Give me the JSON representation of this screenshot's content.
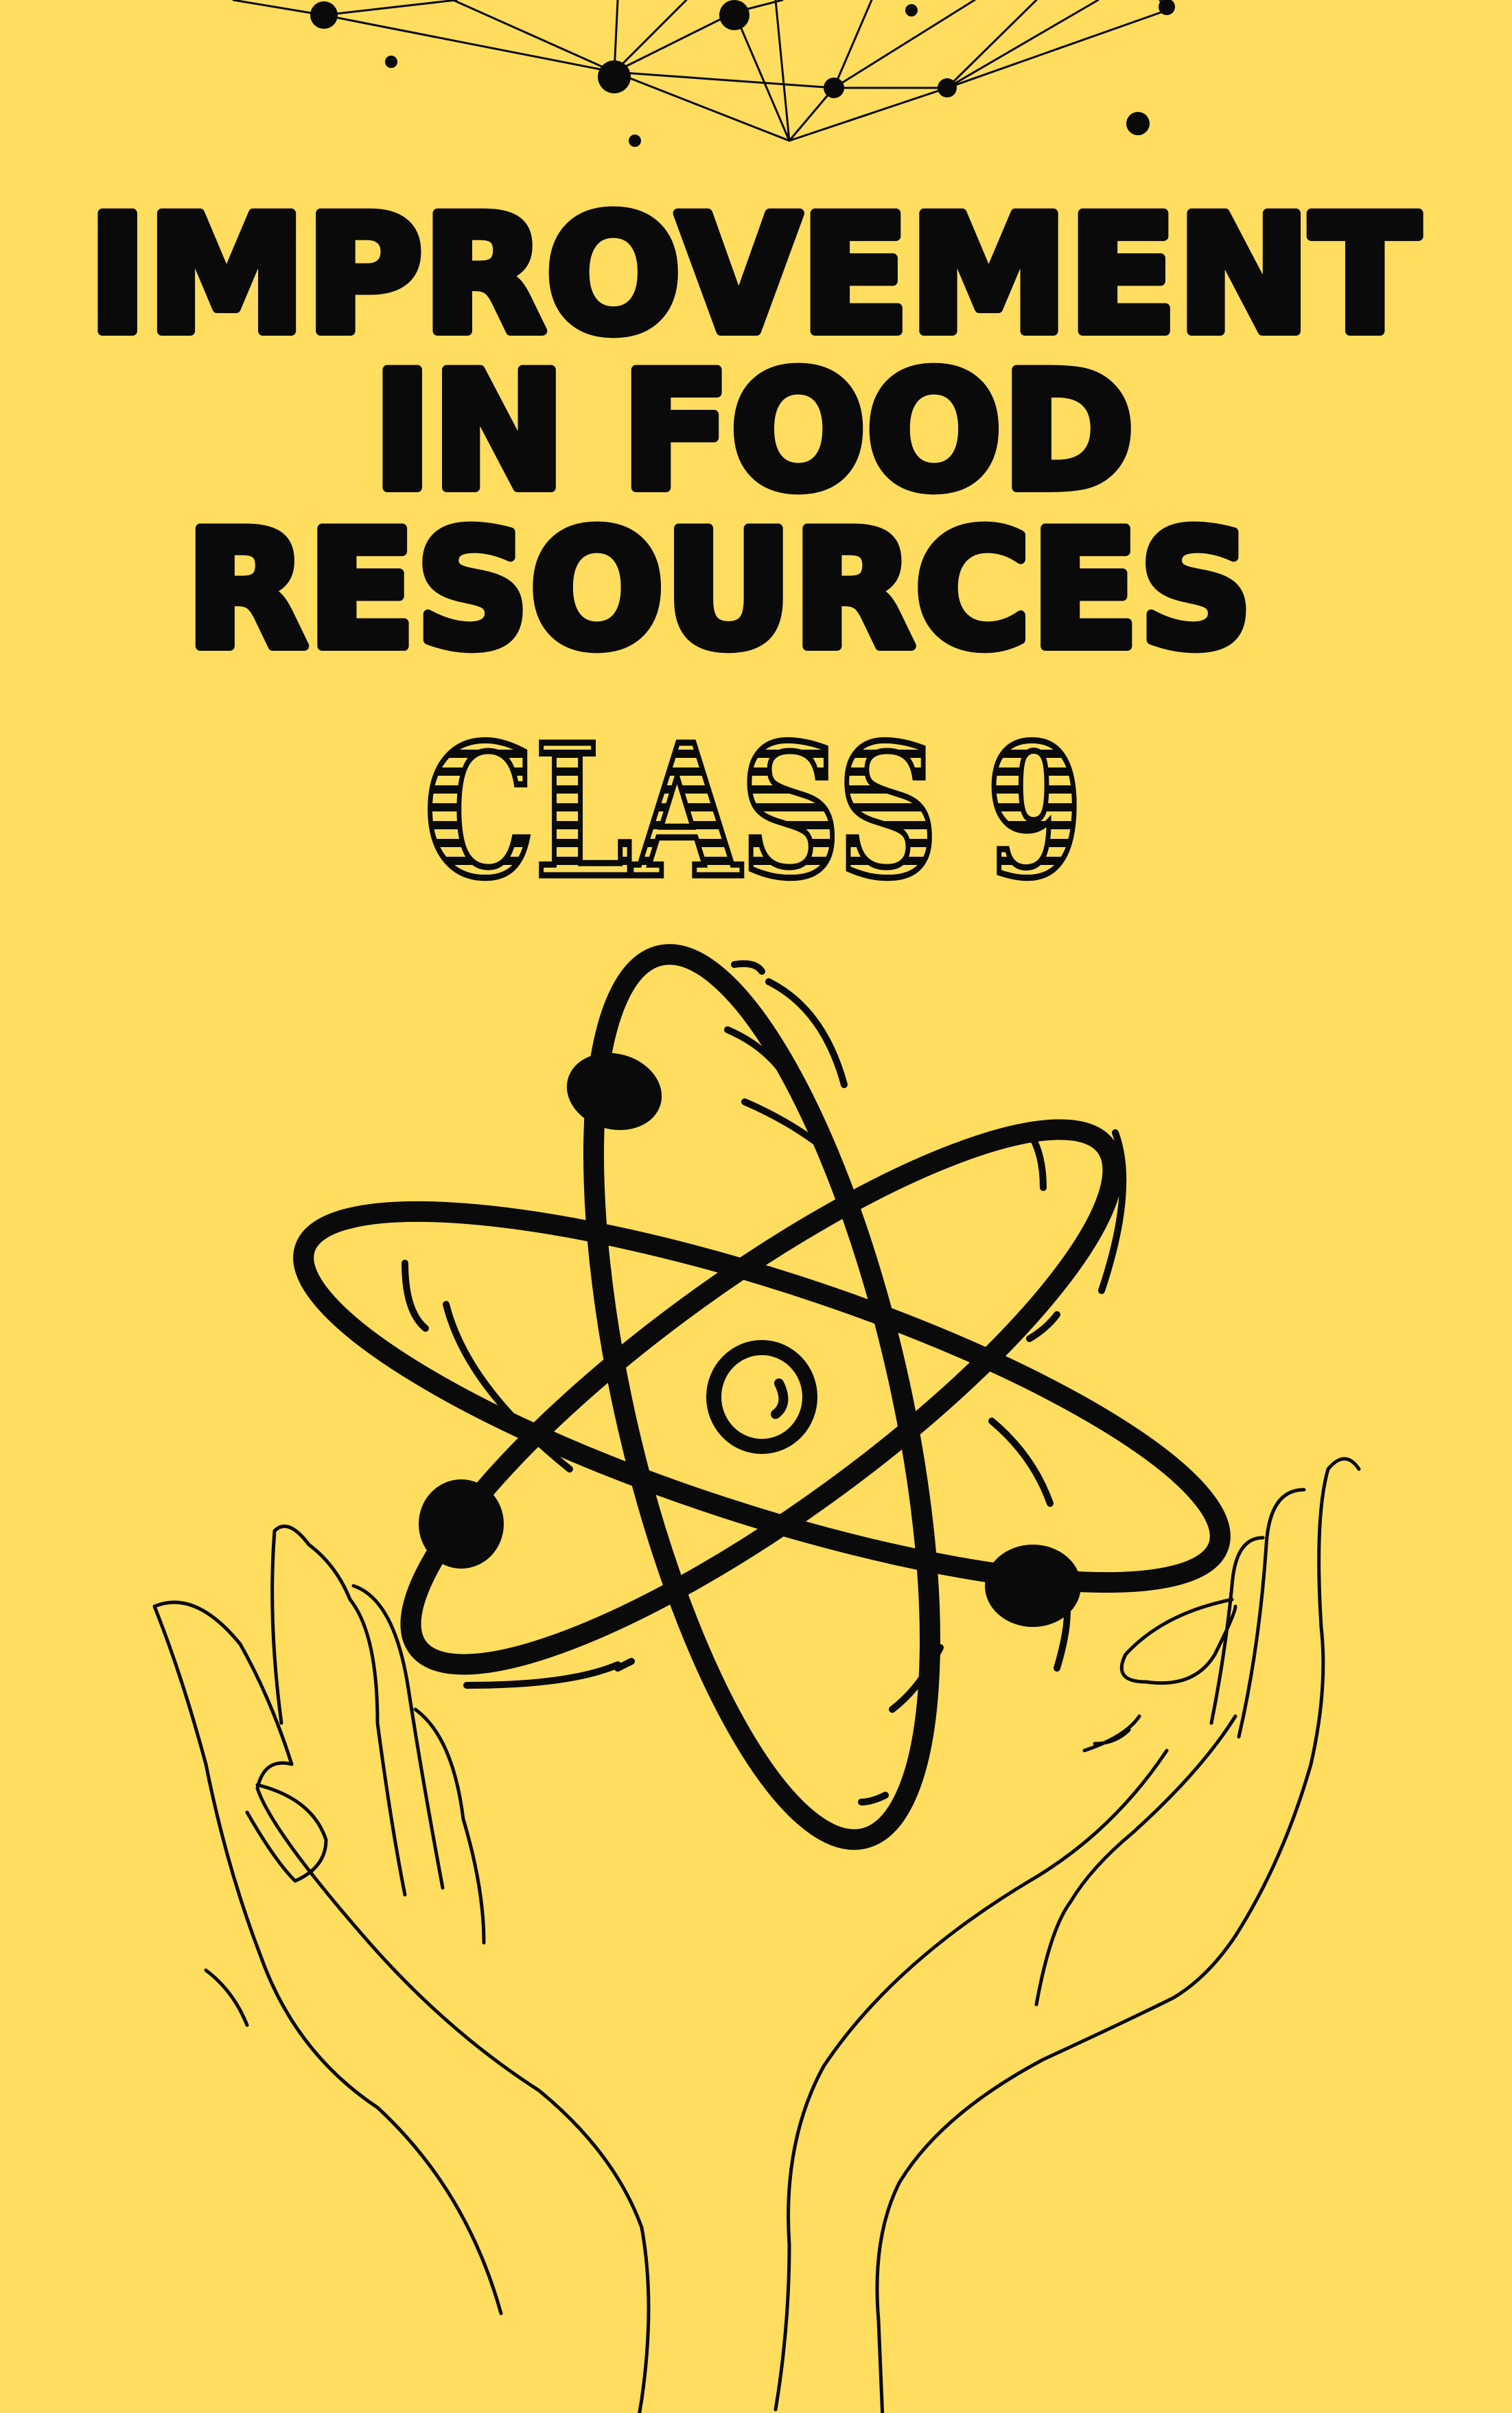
{
  "cover": {
    "title_lines": [
      "IMPROVEMENT",
      "IN FOOD",
      "RESOURCES"
    ],
    "subtitle": "CLASS 9",
    "background_color": "#FEDD5F",
    "ink_color": "#0A0A0A",
    "illustrations": [
      "network-graph",
      "atom-icon",
      "open-hands"
    ]
  }
}
